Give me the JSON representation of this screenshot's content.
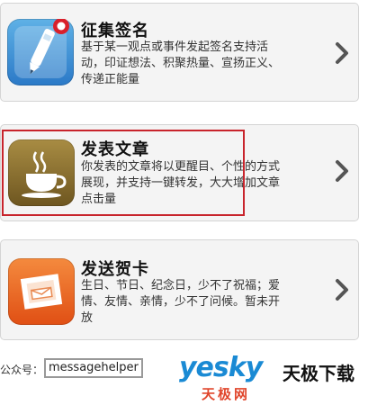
{
  "items": [
    {
      "title": "征集签名",
      "description": "基于某一观点或事件发起签名支持活动，印证想法、积聚热量、宣扬正义、传递正能量",
      "icon": "pen-icon"
    },
    {
      "title": "发表文章",
      "description": "你发表的文章将以更醒目、个性的方式展现，并支持一键转发，大大增加文章点击量",
      "icon": "coffee-cup-icon"
    },
    {
      "title": "发送贺卡",
      "description": "生日、节日、纪念日，少不了祝福；爱情、友情、亲情，少不了问候。暂未开放",
      "icon": "envelope-card-icon"
    }
  ],
  "footer": {
    "label": "公众号：",
    "handle": "messagehelper"
  },
  "watermark": {
    "logo": "yesky",
    "text": "天极下载",
    "subtext": "天极网"
  },
  "colors": {
    "highlight_border": "#c8242c",
    "petition_icon": "#3a8fd6",
    "article_icon": "#8a6f30",
    "card_icon": "#ea6222"
  }
}
